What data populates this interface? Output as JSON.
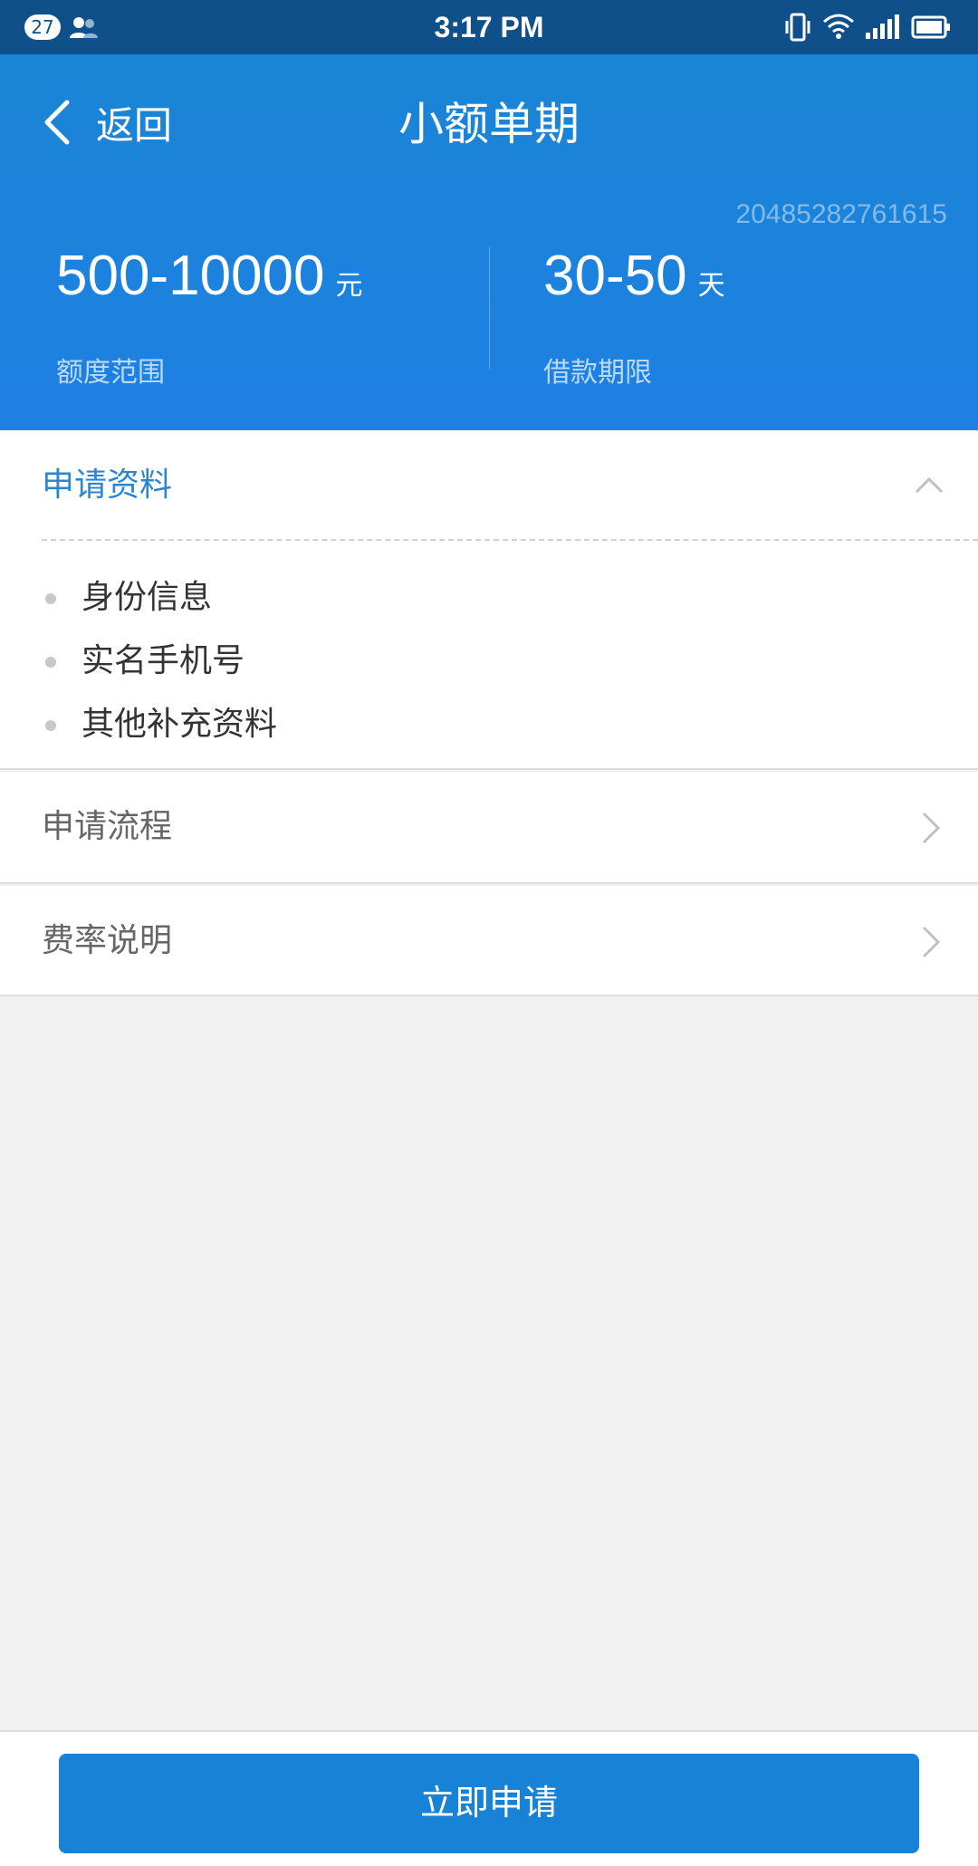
{
  "status_bar": {
    "notification_count": "27",
    "time": "3:17 PM",
    "icons": [
      "contacts-icon",
      "vibrate-icon",
      "wifi-icon",
      "signal-icon",
      "battery-icon"
    ]
  },
  "header": {
    "back_label": "返回",
    "title": "小额单期",
    "product_id": "20485282761615",
    "amount": {
      "value": "500-10000",
      "unit": "元",
      "label": "额度范围"
    },
    "term": {
      "value": "30-50",
      "unit": "天",
      "label": "借款期限"
    }
  },
  "materials": {
    "title": "申请资料",
    "expanded": true,
    "items": [
      "身份信息",
      "实名手机号",
      "其他补充资料"
    ]
  },
  "rows": {
    "process": "申请流程",
    "rate": "费率说明"
  },
  "footer": {
    "apply_label": "立即申请"
  },
  "colors": {
    "status_bar": "#10508a",
    "header": "#1a85d5",
    "accent": "#2a86d2",
    "button": "#1882d6",
    "background": "#f2f2f2"
  }
}
